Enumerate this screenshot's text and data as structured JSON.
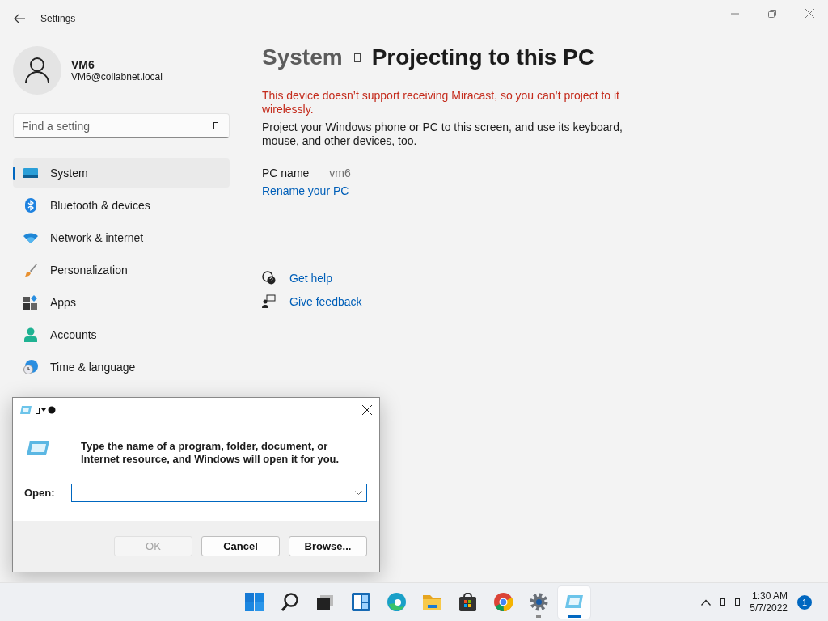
{
  "window": {
    "title": "Settings"
  },
  "user": {
    "name": "VM6",
    "email": "VM6@collabnet.local"
  },
  "search": {
    "placeholder": "Find a setting"
  },
  "nav": [
    {
      "kind": "system",
      "label": "System",
      "selected": true
    },
    {
      "kind": "bluetooth",
      "label": "Bluetooth & devices",
      "selected": false
    },
    {
      "kind": "network",
      "label": "Network & internet",
      "selected": false
    },
    {
      "kind": "personalization",
      "label": "Personalization",
      "selected": false
    },
    {
      "kind": "apps",
      "label": "Apps",
      "selected": false
    },
    {
      "kind": "accounts",
      "label": "Accounts",
      "selected": false
    },
    {
      "kind": "time",
      "label": "Time & language",
      "selected": false
    }
  ],
  "page": {
    "breadcrumb_parent": "System",
    "title": "Projecting to this PC",
    "error": "This device doesn’t support receiving Miracast, so you can’t project to it wirelessly.",
    "description": "Project your Windows phone or PC to this screen, and use its keyboard, mouse, and other devices, too.",
    "pc_name": {
      "label": "PC name",
      "value": "vm6"
    },
    "rename_link": "Rename your PC",
    "help_links": [
      {
        "kind": "help",
        "label": "Get help"
      },
      {
        "kind": "feedback",
        "label": "Give feedback"
      }
    ]
  },
  "run_dialog": {
    "message": "Type the name of a program, folder, document, or Internet resource, and Windows will open it for you.",
    "open_label": "Open:",
    "buttons": [
      {
        "label": "OK",
        "disabled": true
      },
      {
        "label": "Cancel",
        "disabled": false
      },
      {
        "label": "Browse...",
        "disabled": false
      }
    ]
  },
  "taskbar": {
    "apps": [
      {
        "kind": "start",
        "running": false,
        "selected": false
      },
      {
        "kind": "search",
        "running": false,
        "selected": false
      },
      {
        "kind": "taskview",
        "running": false,
        "selected": false
      },
      {
        "kind": "widgets",
        "running": false,
        "selected": false
      },
      {
        "kind": "edge",
        "running": false,
        "selected": false
      },
      {
        "kind": "explorer",
        "running": false,
        "selected": false
      },
      {
        "kind": "store",
        "running": false,
        "selected": false
      },
      {
        "kind": "chrome",
        "running": false,
        "selected": false
      },
      {
        "kind": "settings",
        "running": true,
        "selected": false
      },
      {
        "kind": "run",
        "running": true,
        "selected": true
      }
    ],
    "time": "1:30 AM",
    "date": "5/7/2022",
    "notifications": "1"
  }
}
